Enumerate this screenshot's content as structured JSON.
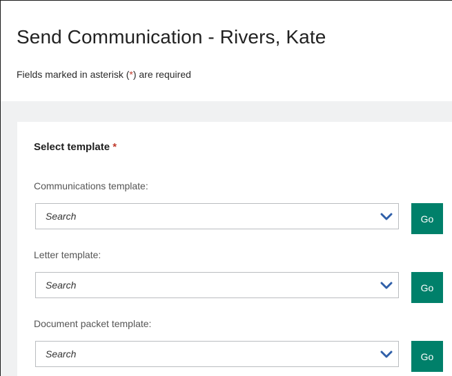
{
  "page": {
    "title": "Send Communication - Rivers, Kate",
    "required_note_prefix": "Fields marked in asterisk (",
    "required_note_mark": "*",
    "required_note_suffix": ") are required"
  },
  "form": {
    "section_title": "Select template",
    "section_required_mark": "*",
    "fields": [
      {
        "label": "Communications template:",
        "placeholder": "Search",
        "button": "Go"
      },
      {
        "label": "Letter template:",
        "placeholder": "Search",
        "button": "Go"
      },
      {
        "label": "Document packet template:",
        "placeholder": "Search",
        "button": "Go"
      }
    ]
  },
  "colors": {
    "accent": "#00806a",
    "chevron": "#2f5fa8",
    "required": "#c0392b",
    "panel_background": "#f0f1f2"
  },
  "icons": {
    "dropdown": "chevron-down-icon"
  }
}
